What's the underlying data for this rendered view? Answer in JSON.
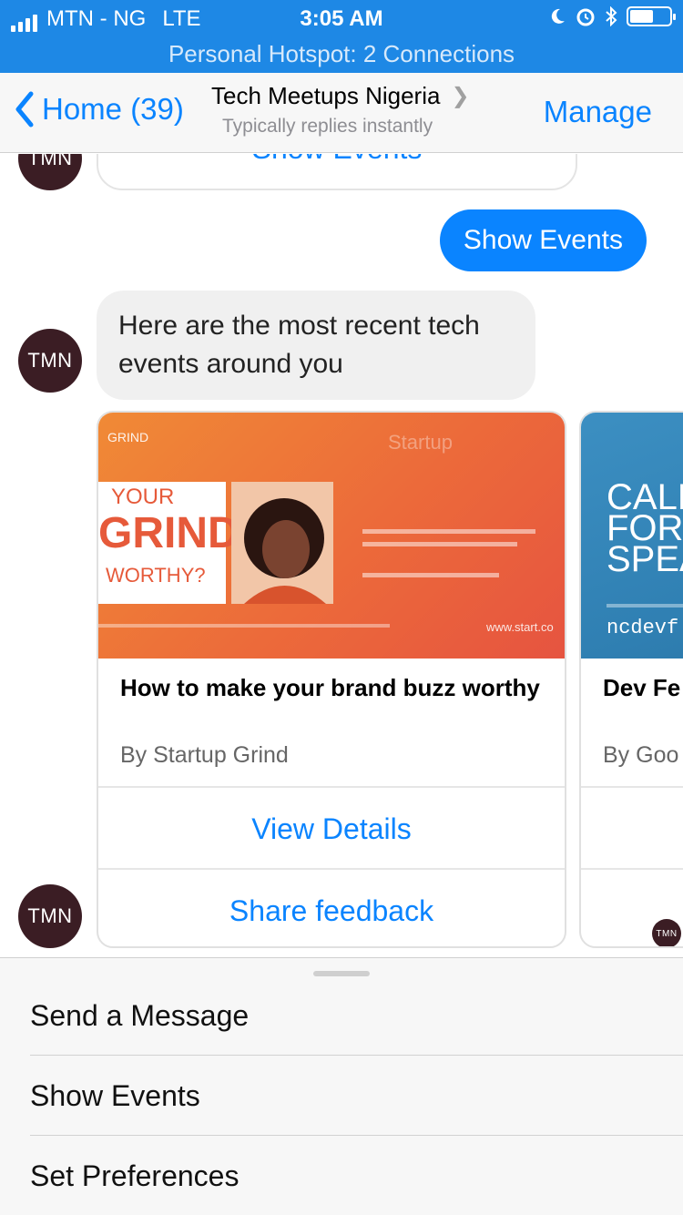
{
  "status_bar": {
    "carrier": "MTN - NG",
    "network": "LTE",
    "time": "3:05 AM",
    "icons": [
      "moon-icon",
      "alarm-icon",
      "bluetooth-icon",
      "battery-icon"
    ],
    "battery_level": 0.55
  },
  "hotspot": {
    "text": "Personal Hotspot: 2 Connections"
  },
  "nav": {
    "back_label": "Home (39)",
    "title": "Tech Meetups Nigeria",
    "subtitle": "Typically replies instantly",
    "action_label": "Manage"
  },
  "chat": {
    "avatar_initials": "TMN",
    "previous_button_label": "Show Events",
    "user_message": "Show Events",
    "bot_message": "Here are the most recent tech events around you",
    "cards": [
      {
        "title": "How to make your brand buzz worthy",
        "subtitle": "By Startup Grind",
        "image": {
          "top_brand": "GRIND",
          "headline_lines": [
            "YOUR",
            "GRIND",
            "WORTHY?"
          ],
          "brand": "Startup",
          "footer_url": "www.start.co"
        },
        "buttons": [
          "View Details",
          "Share feedback"
        ]
      },
      {
        "title": "Dev Fe",
        "subtitle": "By Goo",
        "image": {
          "headline_lines": [
            "CALL",
            "FOR",
            "SPEA"
          ],
          "footer_url": "ncdevf"
        },
        "buttons": [
          "",
          ""
        ]
      }
    ]
  },
  "menu": {
    "items": [
      "Send a Message",
      "Show Events",
      "Set Preferences"
    ]
  },
  "colors": {
    "accent": "#0a84ff",
    "status_bar": "#1e88e5",
    "avatar": "#3b1d24",
    "bot_bubble": "#f0f0f0"
  }
}
